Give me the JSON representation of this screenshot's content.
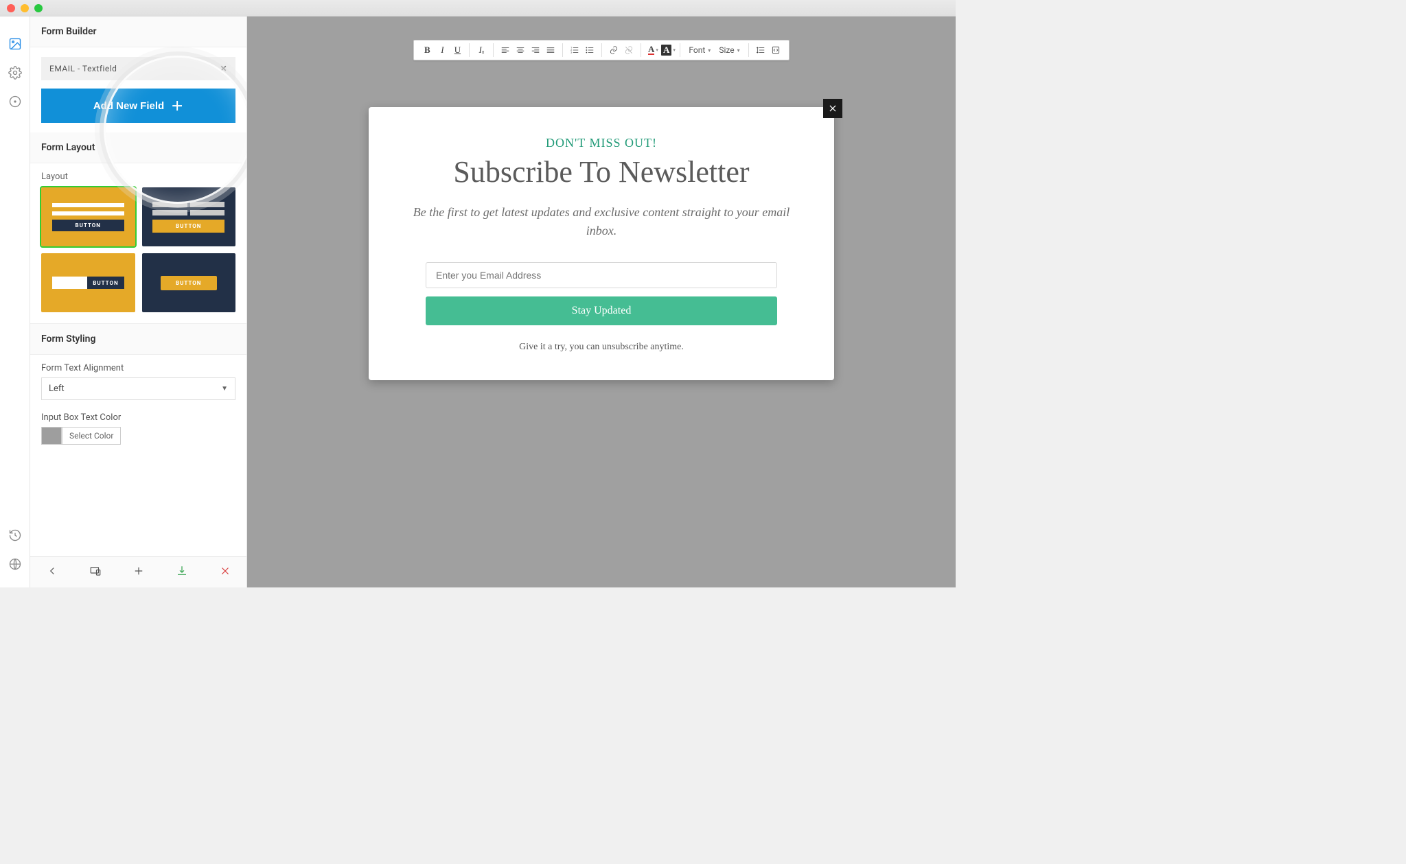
{
  "sidebar": {
    "sections": {
      "form_builder": "Form Builder",
      "form_layout": "Form Layout",
      "form_styling": "Form Styling"
    },
    "field_chip": {
      "label": "EMAIL - Textfield"
    },
    "add_field_btn": "Add New Field",
    "layout_label": "Layout",
    "layout_button_text": "BUTTON",
    "text_align_label": "Form Text Alignment",
    "text_align_value": "Left",
    "input_color_label": "Input Box Text Color",
    "select_color_btn": "Select Color"
  },
  "rte": {
    "font_label": "Font",
    "size_label": "Size"
  },
  "popup": {
    "eyebrow": "DON'T MISS OUT!",
    "title": "Subscribe To Newsletter",
    "subtitle": "Be the first to get latest updates and exclusive content straight to your email inbox.",
    "placeholder": "Enter you Email Address",
    "button": "Stay Updated",
    "footnote": "Give it a try, you can unsubscribe anytime."
  }
}
